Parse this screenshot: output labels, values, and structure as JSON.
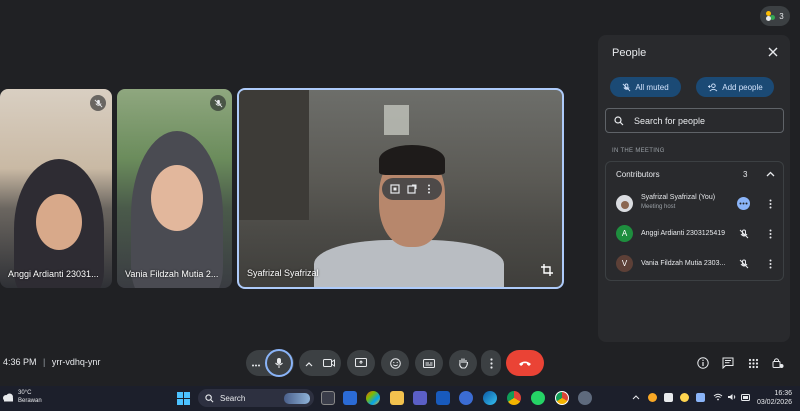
{
  "top_bar": {
    "participant_count": "3"
  },
  "tiles": [
    {
      "name": "Anggi Ardianti 23031..."
    },
    {
      "name": "Vania Fildzah Mutia 2..."
    },
    {
      "name": "Syafrizal Syafrizal"
    }
  ],
  "people_panel": {
    "title": "People",
    "all_muted_label": "All muted",
    "add_people_label": "Add people",
    "search_placeholder": "Search for people",
    "section_label": "IN THE MEETING",
    "group_label": "Contributors",
    "group_count": "3",
    "participants": [
      {
        "name": "Syafrizal Syafrizal (You)",
        "role": "Meeting host"
      },
      {
        "name": "Anggi Ardianti 2303125419",
        "initial": "A",
        "color": "#1e8e3e"
      },
      {
        "name": "Vania Fildzah Mutia 2303...",
        "initial": "V",
        "color": "#5d4037"
      }
    ]
  },
  "meeting": {
    "time": "4:36 PM",
    "separator": "|",
    "code": "yrr-vdhq-ynr"
  },
  "colors": {
    "end_call": "#ea4335",
    "accent": "#8ab4f8",
    "pill": "#1b4a75"
  },
  "taskbar": {
    "weather_temp": "30°C",
    "weather_desc": "Berawan",
    "search_label": "Search",
    "time": "16:36",
    "date": "03/02/2026"
  }
}
